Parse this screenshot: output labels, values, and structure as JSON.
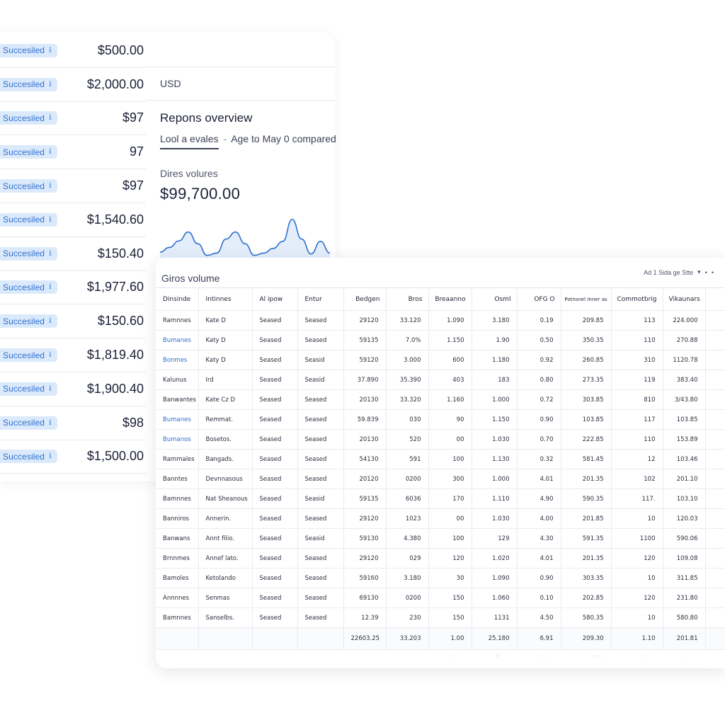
{
  "payments": {
    "rows": [
      {
        "status": "Succesiled",
        "amount": "$500.00"
      },
      {
        "status": "Succesiled",
        "amount": "$2,000.00"
      },
      {
        "status": "Succesiled",
        "amount": "$97"
      },
      {
        "status": "Succesiled",
        "amount": "97"
      },
      {
        "status": "Succesiled",
        "amount": "$97"
      },
      {
        "status": "Succesiled",
        "amount": "$1,540.60"
      },
      {
        "status": "Succesiled",
        "amount": "$150.40"
      },
      {
        "status": "Succesiled",
        "amount": "$1,977.60"
      },
      {
        "status": "Succesiled",
        "amount": "$150.60"
      },
      {
        "status": "Succesiled",
        "amount": "$1,819.40"
      },
      {
        "status": "Succesiled",
        "amount": "$1,900.40"
      },
      {
        "status": "Succesiled",
        "amount": "$98"
      },
      {
        "status": "Succesiled",
        "amount": "$1,500.00"
      }
    ]
  },
  "overview": {
    "currency": "USD",
    "title": "Repons overview",
    "tab_active": "Lool a evales",
    "tab_sep": "-",
    "tab_range": "Age to May 0 compared",
    "metric_label": "Dires volures",
    "metric_value": "$99,700.00",
    "sparkline": [
      0.12,
      0.22,
      0.36,
      0.55,
      0.3,
      0.05,
      0.1,
      0.4,
      0.55,
      0.3,
      0.05,
      0.1,
      0.2,
      0.35,
      0.82,
      0.4,
      0.08,
      0.35,
      0.1
    ]
  },
  "grid": {
    "title": "Giros volume",
    "filter_label": "Ad 1 Sida ge Stte",
    "filter_arrow": "▾",
    "filter_dots": [
      "•",
      "•"
    ],
    "columns": [
      {
        "label": "Dinsinde",
        "align": "l"
      },
      {
        "label": "Intinnes",
        "align": "l"
      },
      {
        "label": "Al ipow",
        "align": "l"
      },
      {
        "label": "Entur",
        "align": "l"
      },
      {
        "label": "Bedgen",
        "align": "r"
      },
      {
        "label": "Bros",
        "align": "r"
      },
      {
        "label": "Breaanno",
        "align": "r"
      },
      {
        "label": "Osml",
        "align": "r"
      },
      {
        "label": "OFG O",
        "align": "r"
      },
      {
        "label": "Potnsnel Inner as",
        "align": "tiny"
      },
      {
        "label": "Commotbrig",
        "align": "r"
      },
      {
        "label": "Vikaunars",
        "align": "r"
      },
      {
        "label": "",
        "align": "r"
      }
    ],
    "rows": [
      {
        "link": false,
        "cells": [
          "Ramnnes",
          "Kate D",
          "Seased",
          "Seased",
          "29120",
          "33.120",
          "1.090",
          "3.180",
          "0.19",
          "209.85",
          "113",
          "224.000",
          ""
        ]
      },
      {
        "link": true,
        "cells": [
          "Bumanes",
          "Katy D",
          "Seased",
          "Seased",
          "59135",
          "7.0%",
          "1.150",
          "1.90",
          "0.50",
          "350.35",
          "110",
          "270.88",
          ""
        ]
      },
      {
        "link": true,
        "cells": [
          "Bonmes",
          "Katy D",
          "Seased",
          "Seasid",
          "59120",
          "3.000",
          "600",
          "1.180",
          "0.92",
          "260.85",
          "310",
          "1120.78",
          ""
        ]
      },
      {
        "link": false,
        "cells": [
          "Kalunus",
          "Ird",
          "Seased",
          "Seasid",
          "37.890",
          "35.390",
          "403",
          "183",
          "0.80",
          "273.35",
          "119",
          "383.40",
          ""
        ]
      },
      {
        "link": false,
        "cells": [
          "Banwantes",
          "Kate Cz D",
          "Seased",
          "Seased",
          "20130",
          "33.320",
          "1.160",
          "1.000",
          "0.72",
          "303.85",
          "810",
          "3/43.80",
          ""
        ]
      },
      {
        "link": true,
        "cells": [
          "Bumanes",
          "Remmat.",
          "Seased",
          "Seased",
          "59.839",
          "030",
          "90",
          "1.150",
          "0.90",
          "103.85",
          "117",
          "103.85",
          ""
        ]
      },
      {
        "link": true,
        "cells": [
          "Bumanos",
          "Bosetos.",
          "Seased",
          "Seased",
          "20130",
          "520",
          "00",
          "1.030",
          "0.70",
          "222.85",
          "110",
          "153.89",
          ""
        ]
      },
      {
        "link": false,
        "cells": [
          "Rammales",
          "Bangads.",
          "Seased",
          "Seased",
          "54130",
          "591",
          "100",
          "1.130",
          "0.32",
          "581.45",
          "12",
          "103.46",
          ""
        ]
      },
      {
        "link": false,
        "cells": [
          "Banntes",
          "Devnnasous",
          "Seased",
          "Seased",
          "20120",
          "0200",
          "300",
          "1.000",
          "4.01",
          "201.35",
          "102",
          "201.10",
          ""
        ]
      },
      {
        "link": false,
        "cells": [
          "Bamnnes",
          "Nat Sheanous",
          "Seased",
          "Seasid",
          "59135",
          "6036",
          "170",
          "1.110",
          "4.90",
          "590.35",
          "117.",
          "103.10",
          ""
        ]
      },
      {
        "link": false,
        "cells": [
          "Banniros",
          "Annerin.",
          "Seased",
          "Seased",
          "29120",
          "1023",
          "00",
          "1.030",
          "4.00",
          "201.85",
          "10",
          "120.03",
          ""
        ]
      },
      {
        "link": false,
        "cells": [
          "Banwans",
          "Annt filio.",
          "Seased",
          "Seasid",
          "59130",
          "4.380",
          "100",
          "129",
          "4.30",
          "591.35",
          "1100",
          "590.06",
          ""
        ]
      },
      {
        "link": false,
        "cells": [
          "Brnnmes",
          "Annef lato.",
          "Seased",
          "Seased",
          "29120",
          "029",
          "120",
          "1.020",
          "4.01",
          "201.35",
          "120",
          "109.08",
          ""
        ]
      },
      {
        "link": false,
        "cells": [
          "Bamoles",
          "Ketolando",
          "Seased",
          "Seased",
          "59160",
          "3.180",
          "30",
          "1.090",
          "0.90",
          "303.35",
          "10",
          "311.85",
          ""
        ]
      },
      {
        "link": false,
        "cells": [
          "Annnnes",
          "Senmas",
          "Seased",
          "Seased",
          "69130",
          "0200",
          "150",
          "1.060",
          "0.10",
          "202.85",
          "120",
          "231.80",
          ""
        ]
      },
      {
        "link": false,
        "cells": [
          "Bamnnes",
          "Sanselbs.",
          "Seased",
          "Seased",
          "12.39",
          "230",
          "150",
          "1131",
          "4.50",
          "580.35",
          "10",
          "580.80",
          ""
        ]
      }
    ],
    "totals": [
      "",
      "",
      "",
      "",
      "22603.25",
      "33.203",
      "1.00",
      "25.180",
      "6.91",
      "209.30",
      "1.10",
      "201.81",
      ""
    ],
    "faint_footer": [
      "",
      "",
      "",
      "",
      "",
      "",
      "···",
      "·/·",
      "·····",
      "··········",
      "···",
      "··",
      ""
    ]
  },
  "colors": {
    "accent": "#2e6fd1",
    "badge_bg": "#dbeafb",
    "sparkline_stroke": "#2f6fd0",
    "sparkline_fill": "#e4eefb",
    "border": "#e6e9ef"
  }
}
